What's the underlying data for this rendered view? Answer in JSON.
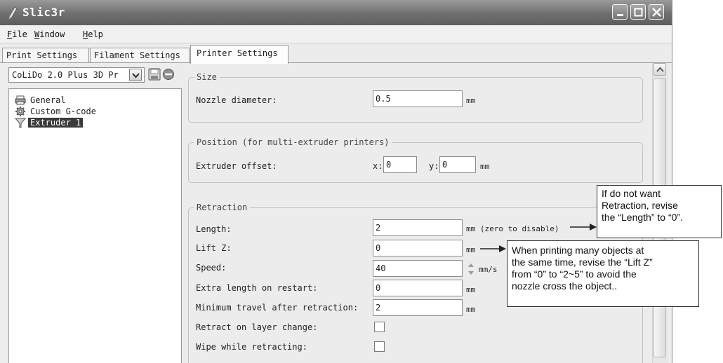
{
  "window": {
    "title": "Slic3r"
  },
  "menu": {
    "items": [
      {
        "accel": "F",
        "rest": "ile"
      },
      {
        "accel": "W",
        "rest": "indow"
      },
      {
        "accel": "H",
        "rest": "elp"
      }
    ]
  },
  "tabs": [
    {
      "label": "Print Settings",
      "active": false
    },
    {
      "label": "Filament Settings",
      "active": false
    },
    {
      "label": "Printer Settings",
      "active": true
    }
  ],
  "preset": {
    "selected": "CoLiDo 2.0 Plus 3D Pr"
  },
  "tree": {
    "items": [
      {
        "label": "General",
        "icon": "printer-icon"
      },
      {
        "label": "Custom G-code",
        "icon": "gear-icon"
      },
      {
        "label": "Extruder 1",
        "icon": "funnel-icon",
        "selected": true
      }
    ]
  },
  "size": {
    "legend": "Size",
    "nozzle_label": "Nozzle diameter:",
    "nozzle_value": "0.5",
    "nozzle_unit": "mm"
  },
  "position": {
    "legend": "Position (for multi-extruder printers)",
    "offset_label": "Extruder offset:",
    "x_label": "x:",
    "x_value": "0",
    "y_label": "y:",
    "y_value": "0",
    "unit": "mm"
  },
  "retraction": {
    "legend": "Retraction",
    "length_label": "Length:",
    "length_value": "2",
    "length_unit": "mm (zero to disable)",
    "liftz_label": "Lift Z:",
    "liftz_value": "0",
    "liftz_unit": "mm",
    "speed_label": "Speed:",
    "speed_value": "40",
    "speed_unit": "mm/s",
    "extra_label": "Extra length on restart:",
    "extra_value": "0",
    "extra_unit": "mm",
    "mintravel_label": "Minimum travel after retraction:",
    "mintravel_value": "2",
    "mintravel_unit": "mm",
    "layerchange_label": "Retract on layer change:",
    "layerchange_checked": false,
    "wipe_label": "Wipe while retracting:",
    "wipe_checked": false
  },
  "annotations": {
    "callout1": [
      "If do not want",
      "Retraction, revise",
      "the “Length” to “0”."
    ],
    "callout2": [
      "When printing many objects at",
      "the same time, revise the “Lift Z”",
      "from “0” to “2~5” to avoid the",
      "nozzle cross the object.."
    ]
  },
  "colors": {
    "titlebar": "#6f6f6f",
    "window_bg": "#ececec",
    "selected_item": "#3a3a3a"
  }
}
